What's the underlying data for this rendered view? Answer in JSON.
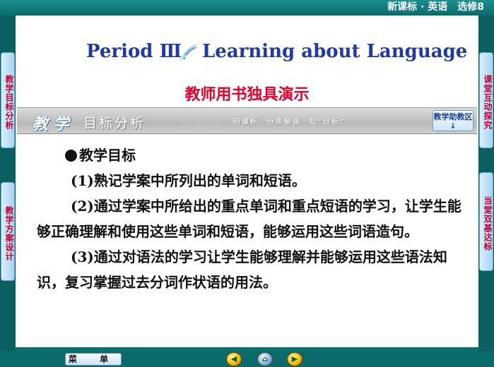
{
  "header": {
    "course": "新课标 · 英语　选修8"
  },
  "title": {
    "left": "Period Ⅲ",
    "right": "Learning about Language"
  },
  "subtitle": "教师用书独具演示",
  "section_banner": {
    "word1": "教 学",
    "word2": "目标分析",
    "tagline": "明课标　分条解读　知“目标”",
    "help_button": "教学助教区↓"
  },
  "content": {
    "heading": "教学目标",
    "items": [
      "(1)熟记学案中所列出的单词和短语。",
      "(2)通过学案中所给出的重点单词和重点短语的学习，让学生能够正确理解和使用这些单词和短语，能够运用这些词语造句。",
      "(3)通过对语法的学习让学生能够理解并能够运用这些语法知识，复习掌握过去分词作状语的用法。"
    ]
  },
  "left_tabs": [
    "教学目标分析",
    "教学方案设计"
  ],
  "right_tabs": [
    "课堂互动探究",
    "当堂双基达标"
  ],
  "bottom": {
    "menu_label": "菜 单"
  },
  "colors": {
    "background": "#0b6f70",
    "title": "#1f3aa6",
    "subtitle": "#e8002a",
    "tab_text": "#c2002e"
  }
}
